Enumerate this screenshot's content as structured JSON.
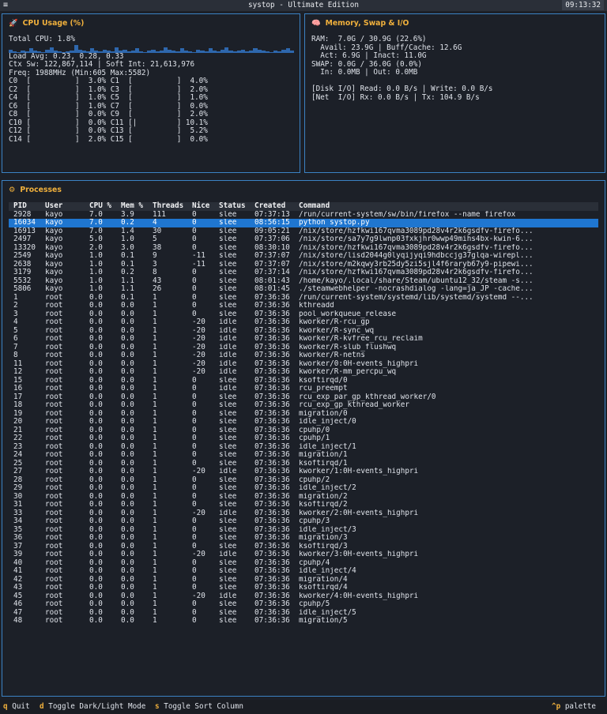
{
  "window": {
    "menu_icon": "menu-icon",
    "title": "systop - Ultimate Edition",
    "clock": "09:13:32"
  },
  "cpu": {
    "title": "CPU Usage (%)",
    "icon": "rocket-icon",
    "total": "Total CPU: 1.8%",
    "sparkline": [
      4,
      2,
      1,
      3,
      2,
      5,
      3,
      2,
      1,
      4,
      6,
      3,
      2,
      1,
      2,
      3,
      9,
      4,
      3,
      2,
      5,
      3,
      2,
      4,
      3,
      2,
      6,
      3,
      4,
      2,
      3,
      5,
      2,
      1,
      3,
      4,
      2,
      3,
      6,
      4,
      3,
      2,
      5,
      3,
      2,
      1,
      4,
      3,
      2,
      5,
      3,
      2,
      4,
      6,
      3,
      2,
      3,
      4,
      2,
      3,
      5,
      4,
      3,
      2,
      1,
      3,
      2,
      4,
      5,
      3
    ],
    "load": "Load Avg: 0.23, 0.28, 0.33",
    "ctx": "Ctx Sw: 122,867,114 | Soft Int: 21,613,976",
    "freq": "Freq: 1988MHz (Min:605 Max:5582)",
    "cores": [
      "C0  [          ]  3.0% C1  [          ]  4.0%",
      "C2  [          ]  1.0% C3  [          ]  2.0%",
      "C4  [          ]  1.0% C5  [          ]  1.0%",
      "C6  [          ]  1.0% C7  [          ]  0.0%",
      "C8  [          ]  0.0% C9  [          ]  2.0%",
      "C10 [          ]  0.0% C11 [|         ] 10.1%",
      "C12 [          ]  0.0% C13 [          ]  5.2%",
      "C14 [          ]  2.0% C15 [          ]  0.0%"
    ]
  },
  "memory": {
    "title": "Memory, Swap & I/O",
    "icon": "brain-icon",
    "lines": [
      "RAM:  7.0G / 30.9G (22.6%)",
      "  Avail: 23.9G | Buff/Cache: 12.6G",
      "  Act: 6.9G | Inact: 11.0G",
      "SWAP: 0.0G / 36.0G (0.0%)",
      "  In: 0.0MB | Out: 0.0MB",
      "",
      "[Disk I/O] Read: 0.0 B/s | Write: 0.0 B/s",
      "[Net  I/O] Rx: 0.0 B/s | Tx: 104.9 B/s"
    ]
  },
  "processes": {
    "title": "Processes",
    "icon": "gear-icon",
    "columns": [
      "PID",
      "User",
      "CPU %",
      "Mem %",
      "Threads",
      "Nice",
      "Status",
      "Created",
      "Command"
    ],
    "selected_pid": "16034",
    "rows": [
      [
        "2928",
        "kayo",
        "7.0",
        "3.9",
        "111",
        "0",
        "slee",
        "07:37:13",
        "/run/current-system/sw/bin/firefox --name firefox"
      ],
      [
        "16034",
        "kayo",
        "7.0",
        "0.2",
        "4",
        "0",
        "slee",
        "08:56:15",
        "python systop.py"
      ],
      [
        "16913",
        "kayo",
        "7.0",
        "1.4",
        "30",
        "0",
        "slee",
        "09:05:21",
        "/nix/store/hzfkwi167qvma3089pd28v4r2k6gsdfv-firefo..."
      ],
      [
        "2497",
        "kayo",
        "5.0",
        "1.0",
        "5",
        "0",
        "slee",
        "07:37:06",
        "/nix/store/sa7y7g9lwnp03fxkjhr0wwp49mihs4bx-kwin-6..."
      ],
      [
        "13320",
        "kayo",
        "2.0",
        "3.0",
        "38",
        "0",
        "slee",
        "08:30:10",
        "/nix/store/hzfkwi167qvma3089pd28v4r2k6gsdfv-firefo..."
      ],
      [
        "2549",
        "kayo",
        "1.0",
        "0.1",
        "9",
        "-11",
        "slee",
        "07:37:07",
        "/nix/store/lisd2044g0lyqijyqi9hdbccjg37glqa-wirepl..."
      ],
      [
        "2638",
        "kayo",
        "1.0",
        "0.1",
        "3",
        "-11",
        "slee",
        "07:37:07",
        "/nix/store/m2kqwy3rb25dy5zi5sjl4f6raryb67y9-pipewi..."
      ],
      [
        "3179",
        "kayo",
        "1.0",
        "0.2",
        "8",
        "0",
        "slee",
        "07:37:14",
        "/nix/store/hzfkwi167qvma3089pd28v4r2k6gsdfv-firefo..."
      ],
      [
        "5532",
        "kayo",
        "1.0",
        "1.1",
        "43",
        "0",
        "slee",
        "08:01:43",
        "/home/kayo/.local/share/Steam/ubuntu12_32/steam -s..."
      ],
      [
        "5806",
        "kayo",
        "1.0",
        "1.1",
        "26",
        "0",
        "slee",
        "08:01:45",
        "./steamwebhelper -nocrashdialog -lang=ja_JP -cache..."
      ],
      [
        "1",
        "root",
        "0.0",
        "0.1",
        "1",
        "0",
        "slee",
        "07:36:36",
        "/run/current-system/systemd/lib/systemd/systemd --..."
      ],
      [
        "2",
        "root",
        "0.0",
        "0.0",
        "1",
        "0",
        "slee",
        "07:36:36",
        "kthreadd"
      ],
      [
        "3",
        "root",
        "0.0",
        "0.0",
        "1",
        "0",
        "slee",
        "07:36:36",
        "pool_workqueue_release"
      ],
      [
        "4",
        "root",
        "0.0",
        "0.0",
        "1",
        "-20",
        "idle",
        "07:36:36",
        "kworker/R-rcu_gp"
      ],
      [
        "5",
        "root",
        "0.0",
        "0.0",
        "1",
        "-20",
        "idle",
        "07:36:36",
        "kworker/R-sync_wq"
      ],
      [
        "6",
        "root",
        "0.0",
        "0.0",
        "1",
        "-20",
        "idle",
        "07:36:36",
        "kworker/R-kvfree_rcu_reclaim"
      ],
      [
        "7",
        "root",
        "0.0",
        "0.0",
        "1",
        "-20",
        "idle",
        "07:36:36",
        "kworker/R-slub_flushwq"
      ],
      [
        "8",
        "root",
        "0.0",
        "0.0",
        "1",
        "-20",
        "idle",
        "07:36:36",
        "kworker/R-netns"
      ],
      [
        "11",
        "root",
        "0.0",
        "0.0",
        "1",
        "-20",
        "idle",
        "07:36:36",
        "kworker/0:0H-events_highpri"
      ],
      [
        "12",
        "root",
        "0.0",
        "0.0",
        "1",
        "-20",
        "idle",
        "07:36:36",
        "kworker/R-mm_percpu_wq"
      ],
      [
        "15",
        "root",
        "0.0",
        "0.0",
        "1",
        "0",
        "slee",
        "07:36:36",
        "ksoftirqd/0"
      ],
      [
        "16",
        "root",
        "0.0",
        "0.0",
        "1",
        "0",
        "idle",
        "07:36:36",
        "rcu_preempt"
      ],
      [
        "17",
        "root",
        "0.0",
        "0.0",
        "1",
        "0",
        "slee",
        "07:36:36",
        "rcu_exp_par_gp_kthread_worker/0"
      ],
      [
        "18",
        "root",
        "0.0",
        "0.0",
        "1",
        "0",
        "slee",
        "07:36:36",
        "rcu_exp_gp_kthread_worker"
      ],
      [
        "19",
        "root",
        "0.0",
        "0.0",
        "1",
        "0",
        "slee",
        "07:36:36",
        "migration/0"
      ],
      [
        "20",
        "root",
        "0.0",
        "0.0",
        "1",
        "0",
        "slee",
        "07:36:36",
        "idle_inject/0"
      ],
      [
        "21",
        "root",
        "0.0",
        "0.0",
        "1",
        "0",
        "slee",
        "07:36:36",
        "cpuhp/0"
      ],
      [
        "22",
        "root",
        "0.0",
        "0.0",
        "1",
        "0",
        "slee",
        "07:36:36",
        "cpuhp/1"
      ],
      [
        "23",
        "root",
        "0.0",
        "0.0",
        "1",
        "0",
        "slee",
        "07:36:36",
        "idle_inject/1"
      ],
      [
        "24",
        "root",
        "0.0",
        "0.0",
        "1",
        "0",
        "slee",
        "07:36:36",
        "migration/1"
      ],
      [
        "25",
        "root",
        "0.0",
        "0.0",
        "1",
        "0",
        "slee",
        "07:36:36",
        "ksoftirqd/1"
      ],
      [
        "27",
        "root",
        "0.0",
        "0.0",
        "1",
        "-20",
        "idle",
        "07:36:36",
        "kworker/1:0H-events_highpri"
      ],
      [
        "28",
        "root",
        "0.0",
        "0.0",
        "1",
        "0",
        "slee",
        "07:36:36",
        "cpuhp/2"
      ],
      [
        "29",
        "root",
        "0.0",
        "0.0",
        "1",
        "0",
        "slee",
        "07:36:36",
        "idle_inject/2"
      ],
      [
        "30",
        "root",
        "0.0",
        "0.0",
        "1",
        "0",
        "slee",
        "07:36:36",
        "migration/2"
      ],
      [
        "31",
        "root",
        "0.0",
        "0.0",
        "1",
        "0",
        "slee",
        "07:36:36",
        "ksoftirqd/2"
      ],
      [
        "33",
        "root",
        "0.0",
        "0.0",
        "1",
        "-20",
        "idle",
        "07:36:36",
        "kworker/2:0H-events_highpri"
      ],
      [
        "34",
        "root",
        "0.0",
        "0.0",
        "1",
        "0",
        "slee",
        "07:36:36",
        "cpuhp/3"
      ],
      [
        "35",
        "root",
        "0.0",
        "0.0",
        "1",
        "0",
        "slee",
        "07:36:36",
        "idle_inject/3"
      ],
      [
        "36",
        "root",
        "0.0",
        "0.0",
        "1",
        "0",
        "slee",
        "07:36:36",
        "migration/3"
      ],
      [
        "37",
        "root",
        "0.0",
        "0.0",
        "1",
        "0",
        "slee",
        "07:36:36",
        "ksoftirqd/3"
      ],
      [
        "39",
        "root",
        "0.0",
        "0.0",
        "1",
        "-20",
        "idle",
        "07:36:36",
        "kworker/3:0H-events_highpri"
      ],
      [
        "40",
        "root",
        "0.0",
        "0.0",
        "1",
        "0",
        "slee",
        "07:36:36",
        "cpuhp/4"
      ],
      [
        "41",
        "root",
        "0.0",
        "0.0",
        "1",
        "0",
        "slee",
        "07:36:36",
        "idle_inject/4"
      ],
      [
        "42",
        "root",
        "0.0",
        "0.0",
        "1",
        "0",
        "slee",
        "07:36:36",
        "migration/4"
      ],
      [
        "43",
        "root",
        "0.0",
        "0.0",
        "1",
        "0",
        "slee",
        "07:36:36",
        "ksoftirqd/4"
      ],
      [
        "45",
        "root",
        "0.0",
        "0.0",
        "1",
        "-20",
        "idle",
        "07:36:36",
        "kworker/4:0H-events_highpri"
      ],
      [
        "46",
        "root",
        "0.0",
        "0.0",
        "1",
        "0",
        "slee",
        "07:36:36",
        "cpuhp/5"
      ],
      [
        "47",
        "root",
        "0.0",
        "0.0",
        "1",
        "0",
        "slee",
        "07:36:36",
        "idle_inject/5"
      ],
      [
        "48",
        "root",
        "0.0",
        "0.0",
        "1",
        "0",
        "slee",
        "07:36:36",
        "migration/5"
      ]
    ]
  },
  "footer": {
    "quit_key": "q",
    "quit_label": "Quit",
    "theme_key": "d",
    "theme_label": "Toggle Dark/Light Mode",
    "sort_key": "s",
    "sort_label": "Toggle Sort Column",
    "palette_key": "^p",
    "palette_label": "palette"
  },
  "colors": {
    "accent": "#f0b03c",
    "border": "#3b82c4",
    "selection": "#1f76d0",
    "spark": "#2e67ad"
  }
}
